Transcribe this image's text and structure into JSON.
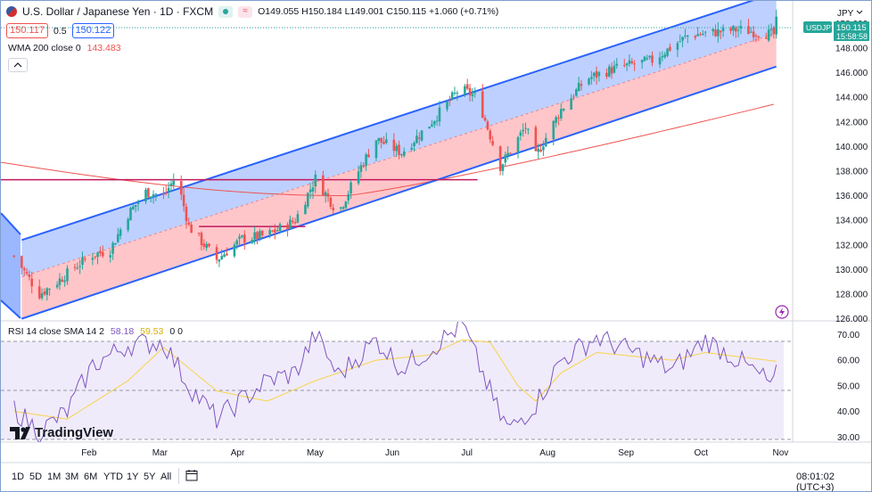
{
  "header": {
    "symbol_title": "U.S. Dollar / Japanese Yen · 1D · FXCM",
    "ohlc": "O149.055 H150.184 L149.001 C150.115 +1.060 (+0.71%)",
    "bid": "150.117",
    "spread": "0.5",
    "ask": "150.122",
    "wma_label": "WMA 200 close 0",
    "wma_value": "143.483",
    "rsi_label": "RSI 14 close SMA 14 2",
    "rsi_value": "58.18",
    "rsi_sma_value": "59.53",
    "rsi_extra": "0 0"
  },
  "right_axis": {
    "currency": "JPY",
    "ticker_badge": "USDJPY",
    "last_price": "150.115",
    "countdown": "15:58:58",
    "price_ticks": [
      "150.000",
      "148.000",
      "146.000",
      "144.000",
      "142.000",
      "140.000",
      "138.000",
      "136.000",
      "134.000",
      "132.000",
      "130.000",
      "128.000",
      "126.000"
    ],
    "rsi_ticks": [
      "70.00",
      "60.00",
      "50.00",
      "40.00",
      "30.00"
    ]
  },
  "bottom_bar": {
    "time_axis": [
      "Feb",
      "Mar",
      "Apr",
      "May",
      "Jun",
      "Jul",
      "Aug",
      "Sep",
      "Oct",
      "Nov"
    ],
    "timeframes": [
      "1D",
      "5D",
      "1M",
      "3M",
      "6M",
      "YTD",
      "1Y",
      "5Y",
      "All"
    ],
    "clock": "08:01:02 (UTC+3)"
  },
  "branding": {
    "logo_text": "TradingView"
  },
  "colors": {
    "up": "#26a69a",
    "down": "#ef5350",
    "wma": "#ef5350",
    "rsi": "#7e57c2",
    "rsi_sma": "#f7d44c",
    "channel_line": "#2962ff",
    "channel_upper_fill": "#9bb7ff",
    "channel_lower_fill": "#ffb3b8",
    "hline": "#c2185b"
  },
  "chart_data": {
    "type": "candlestick",
    "instrument": "U.S. Dollar / Japanese Yen",
    "timeframe": "1D",
    "source": "FXCM",
    "ylim": [
      125.9,
      151.4
    ],
    "x_months": [
      "Feb",
      "Mar",
      "Apr",
      "May",
      "Jun",
      "Jul",
      "Aug",
      "Sep",
      "Oct",
      "Nov"
    ],
    "close_path": [
      {
        "x": "Jan 03",
        "y": 131.1
      },
      {
        "x": "Jan 13",
        "y": 128.0
      },
      {
        "x": "Jan 20",
        "y": 129.0
      },
      {
        "x": "Jan 27",
        "y": 130.2
      },
      {
        "x": "Feb 03",
        "y": 131.2
      },
      {
        "x": "Feb 10",
        "y": 131.6
      },
      {
        "x": "Feb 17",
        "y": 134.5
      },
      {
        "x": "Feb 24",
        "y": 136.3
      },
      {
        "x": "Mar 03",
        "y": 136.0
      },
      {
        "x": "Mar 08",
        "y": 137.6
      },
      {
        "x": "Mar 13",
        "y": 133.5
      },
      {
        "x": "Mar 24",
        "y": 130.8
      },
      {
        "x": "Apr 03",
        "y": 132.5
      },
      {
        "x": "Apr 13",
        "y": 132.8
      },
      {
        "x": "Apr 24",
        "y": 134.0
      },
      {
        "x": "May 02",
        "y": 137.4
      },
      {
        "x": "May 11",
        "y": 134.6
      },
      {
        "x": "May 19",
        "y": 138.0
      },
      {
        "x": "May 26",
        "y": 140.6
      },
      {
        "x": "Jun 05",
        "y": 139.5
      },
      {
        "x": "Jun 16",
        "y": 141.8
      },
      {
        "x": "Jun 28",
        "y": 144.7
      },
      {
        "x": "Jul 05",
        "y": 144.0
      },
      {
        "x": "Jul 14",
        "y": 138.4
      },
      {
        "x": "Jul 24",
        "y": 141.6
      },
      {
        "x": "Jul 28",
        "y": 139.2
      },
      {
        "x": "Aug 07",
        "y": 143.0
      },
      {
        "x": "Aug 17",
        "y": 145.5
      },
      {
        "x": "Aug 29",
        "y": 146.4
      },
      {
        "x": "Sep 12",
        "y": 147.0
      },
      {
        "x": "Sep 26",
        "y": 149.0
      },
      {
        "x": "Oct 03",
        "y": 149.2
      },
      {
        "x": "Oct 16",
        "y": 149.5
      },
      {
        "x": "Oct 30",
        "y": 149.1
      },
      {
        "x": "Oct 31",
        "y": 150.115
      }
    ],
    "wma200": {
      "last_value": 143.483
    },
    "regression_channel": {
      "upper": [
        {
          "x": "Jan 06",
          "y": 132.4
        },
        {
          "x": "Oct 31",
          "y": 152.5
        }
      ],
      "middle": [
        {
          "x": "Jan 06",
          "y": 129.4
        },
        {
          "x": "Oct 31",
          "y": 149.2
        }
      ],
      "lower": [
        {
          "x": "Jan 06",
          "y": 126.0
        },
        {
          "x": "Oct 31",
          "y": 146.5
        }
      ]
    },
    "horizontal_lines": [
      {
        "y": 137.3,
        "from": "Dec 28",
        "to": "Jul 05"
      },
      {
        "y": 133.5,
        "from": "Mar 17",
        "to": "Apr 28"
      }
    ],
    "rsi": {
      "period": 14,
      "ylim": [
        28,
        75
      ],
      "levels": [
        70,
        50,
        30
      ],
      "path": [
        {
          "x": "Jan 03",
          "y": 41
        },
        {
          "x": "Jan 13",
          "y": 32
        },
        {
          "x": "Jan 24",
          "y": 40
        },
        {
          "x": "Feb 03",
          "y": 58
        },
        {
          "x": "Feb 17",
          "y": 66
        },
        {
          "x": "Mar 03",
          "y": 67
        },
        {
          "x": "Mar 13",
          "y": 50
        },
        {
          "x": "Mar 24",
          "y": 37
        },
        {
          "x": "Apr 13",
          "y": 52
        },
        {
          "x": "Apr 24",
          "y": 55
        },
        {
          "x": "May 02",
          "y": 70
        },
        {
          "x": "May 11",
          "y": 54
        },
        {
          "x": "May 26",
          "y": 68
        },
        {
          "x": "Jun 05",
          "y": 57
        },
        {
          "x": "Jun 16",
          "y": 64
        },
        {
          "x": "Jun 29",
          "y": 74
        },
        {
          "x": "Jul 14",
          "y": 38
        },
        {
          "x": "Jul 18",
          "y": 33
        },
        {
          "x": "Jul 28",
          "y": 43
        },
        {
          "x": "Aug 07",
          "y": 60
        },
        {
          "x": "Aug 21",
          "y": 69
        },
        {
          "x": "Sep 07",
          "y": 62
        },
        {
          "x": "Sep 20",
          "y": 56
        },
        {
          "x": "Oct 03",
          "y": 68
        },
        {
          "x": "Oct 16",
          "y": 60
        },
        {
          "x": "Oct 30",
          "y": 50
        },
        {
          "x": "Oct 31",
          "y": 58.18
        }
      ],
      "sma": [
        {
          "x": "Jan 03",
          "y": 40
        },
        {
          "x": "Jan 24",
          "y": 37
        },
        {
          "x": "Feb 17",
          "y": 52
        },
        {
          "x": "Mar 03",
          "y": 65
        },
        {
          "x": "Mar 24",
          "y": 48
        },
        {
          "x": "Apr 13",
          "y": 44
        },
        {
          "x": "May 02",
          "y": 52
        },
        {
          "x": "May 26",
          "y": 60
        },
        {
          "x": "Jun 16",
          "y": 62
        },
        {
          "x": "Jun 29",
          "y": 68
        },
        {
          "x": "Jul 10",
          "y": 67
        },
        {
          "x": "Jul 21",
          "y": 50
        },
        {
          "x": "Jul 28",
          "y": 44
        },
        {
          "x": "Aug 07",
          "y": 55
        },
        {
          "x": "Aug 21",
          "y": 63
        },
        {
          "x": "Sep 20",
          "y": 60
        },
        {
          "x": "Oct 03",
          "y": 63
        },
        {
          "x": "Oct 31",
          "y": 59.53
        }
      ]
    }
  }
}
